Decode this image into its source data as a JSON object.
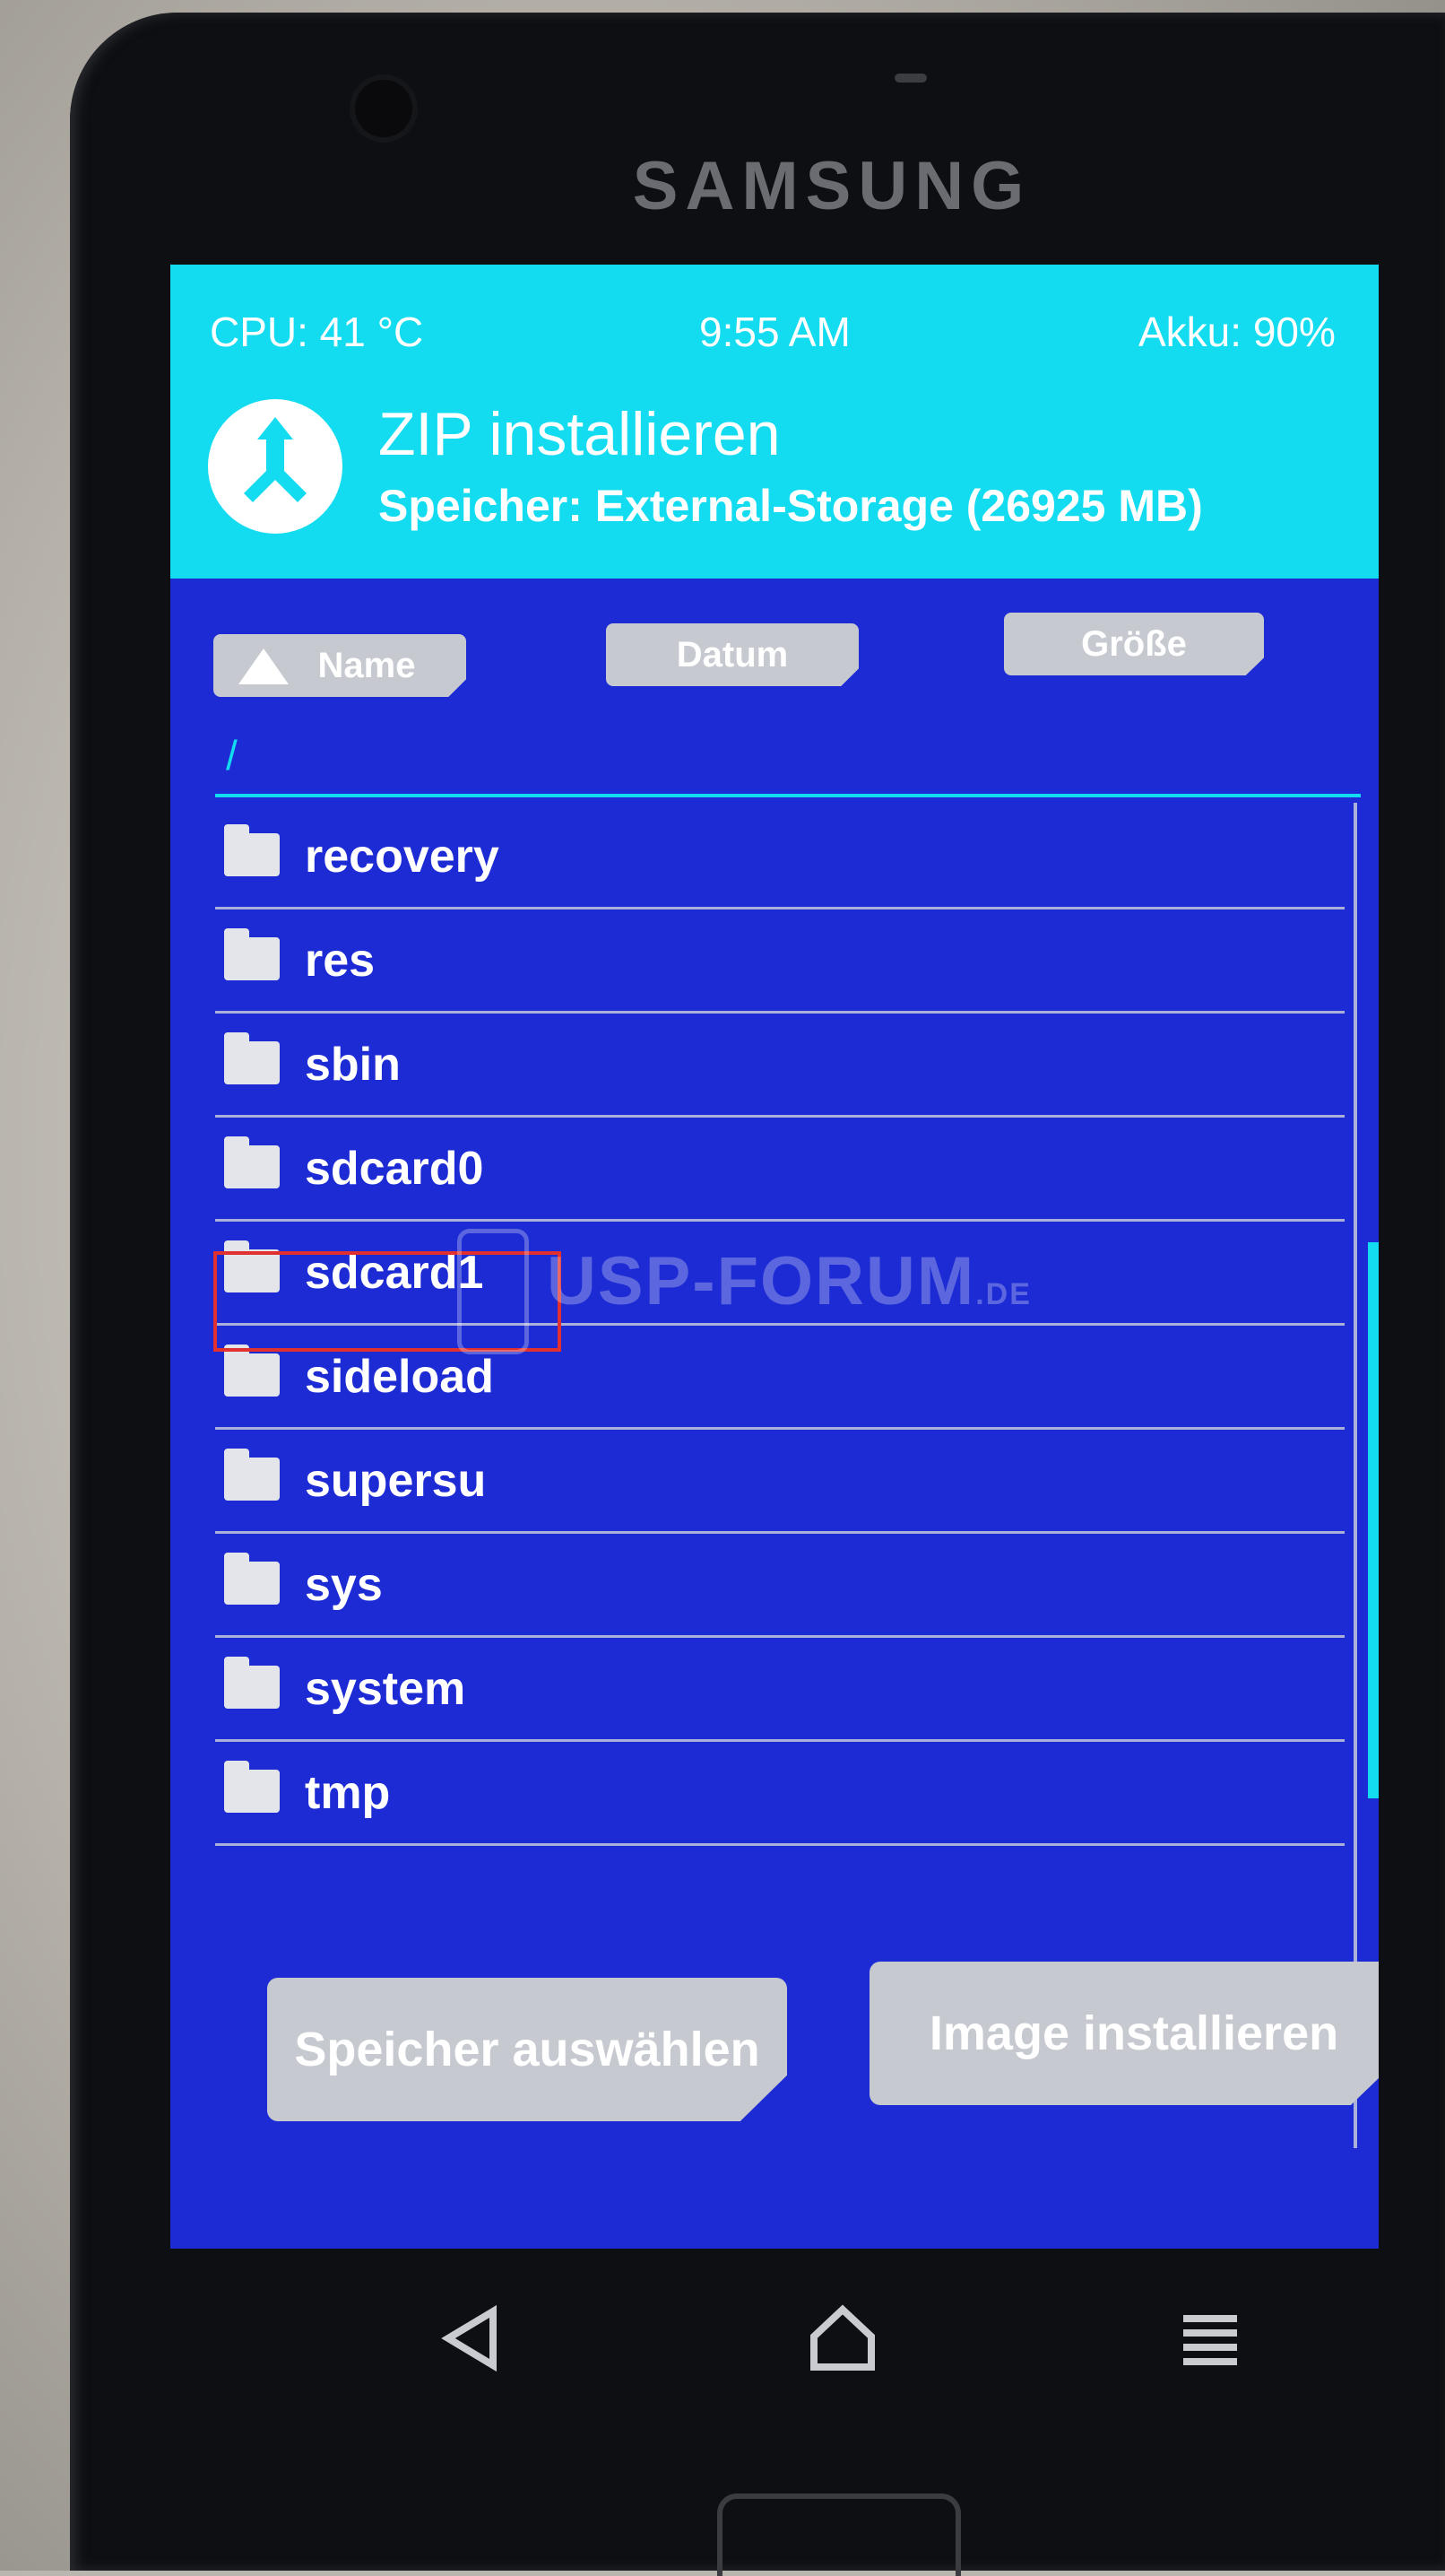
{
  "device": {
    "brand": "SAMSUNG"
  },
  "status_bar": {
    "cpu": "CPU: 41 °C",
    "time": "9:55 AM",
    "battery": "Akku: 90%"
  },
  "header": {
    "title": "ZIP installieren",
    "subtitle": "Speicher: External-Storage (26925 MB)"
  },
  "sort": {
    "name_label": "Name",
    "date_label": "Datum",
    "size_label": "Größe"
  },
  "path": "/",
  "files": [
    {
      "name": "recovery"
    },
    {
      "name": "res"
    },
    {
      "name": "sbin"
    },
    {
      "name": "sdcard0"
    },
    {
      "name": "sdcard1"
    },
    {
      "name": "sideload"
    },
    {
      "name": "supersu"
    },
    {
      "name": "sys"
    },
    {
      "name": "system"
    },
    {
      "name": "tmp"
    }
  ],
  "highlighted_item": "sdcard1",
  "watermark": {
    "text": "USP-FORUM",
    "suffix": ".DE"
  },
  "actions": {
    "select_storage_label": "Speicher auswählen",
    "install_image_label": "Image installieren"
  },
  "colors": {
    "accent": "#13dcf0",
    "background": "#1c2bd3",
    "button": "#c6c9cf",
    "highlight": "#e03030"
  },
  "nav_icons": [
    "back-icon",
    "home-icon",
    "menu-icon"
  ]
}
